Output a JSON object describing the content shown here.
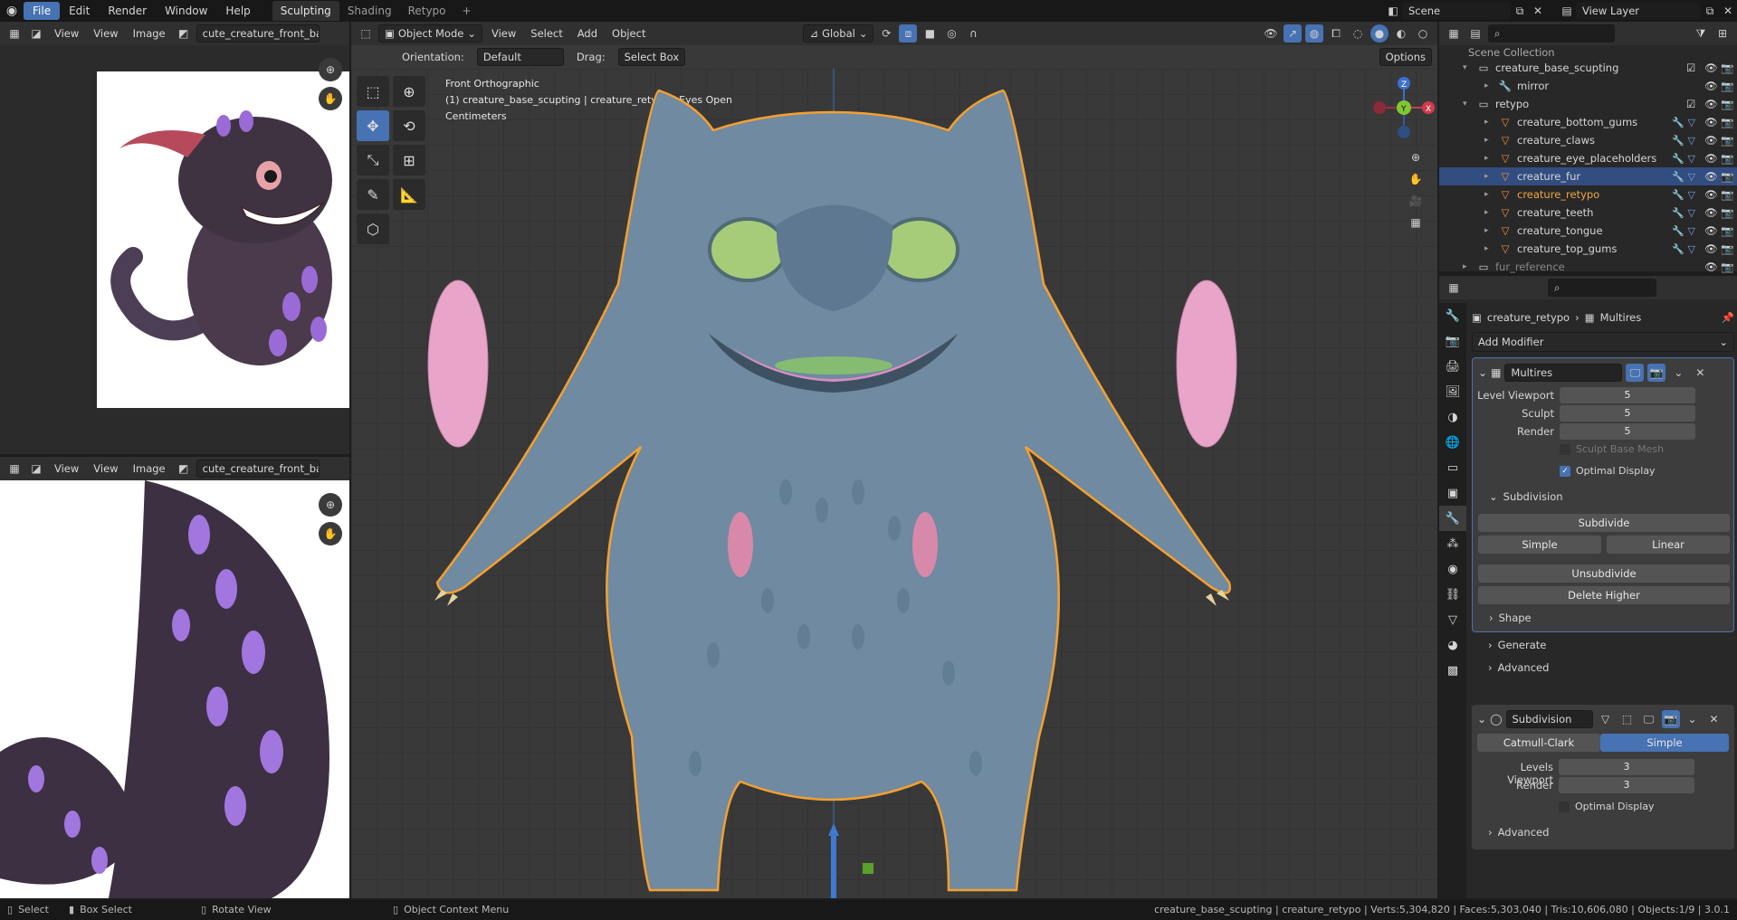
{
  "topbar": {
    "menus": [
      "File",
      "Edit",
      "Render",
      "Window",
      "Help"
    ],
    "workspaces": [
      "Sculpting",
      "Shading",
      "Retypo"
    ],
    "add_tab": "+",
    "scene": "Scene",
    "view_layer": "View Layer"
  },
  "image_editor_top": {
    "view": "View",
    "view2": "View",
    "image": "Image",
    "filename": "cute_creature_front_back."
  },
  "image_editor_bottom": {
    "view": "View",
    "view2": "View",
    "image": "Image",
    "filename": "cute_creature_front_back."
  },
  "viewport": {
    "mode": "Object Mode",
    "menus": [
      "View",
      "Select",
      "Add",
      "Object"
    ],
    "transform": "Global",
    "orientation_label": "Orientation:",
    "orientation_value": "Default",
    "drag_label": "Drag:",
    "drag_value": "Select Box",
    "options": "Options",
    "overlay_line1": "Front Orthographic",
    "overlay_line2": "(1) creature_base_scupting | creature_retypo : Eyes Open",
    "overlay_line3": "Centimeters",
    "gizmo": {
      "z": "Z",
      "y": "Y",
      "x": "X"
    }
  },
  "outliner": {
    "collection_header": "Scene Collection",
    "rows": [
      {
        "name": "creature_base_scupting",
        "level": 1,
        "type": "collection"
      },
      {
        "name": "mirror",
        "level": 2,
        "type": "modifier"
      },
      {
        "name": "retypo",
        "level": 1,
        "type": "collection"
      },
      {
        "name": "creature_bottom_gums",
        "level": 2,
        "type": "mesh"
      },
      {
        "name": "creature_claws",
        "level": 2,
        "type": "mesh"
      },
      {
        "name": "creature_eye_placeholders",
        "level": 2,
        "type": "mesh"
      },
      {
        "name": "creature_fur",
        "level": 2,
        "type": "mesh"
      },
      {
        "name": "creature_retypo",
        "level": 2,
        "type": "mesh"
      },
      {
        "name": "creature_teeth",
        "level": 2,
        "type": "mesh"
      },
      {
        "name": "creature_tongue",
        "level": 2,
        "type": "mesh"
      },
      {
        "name": "creature_top_gums",
        "level": 2,
        "type": "mesh"
      },
      {
        "name": "fur_reference",
        "level": 1,
        "type": "collection"
      }
    ]
  },
  "properties": {
    "breadcrumb_object": "creature_retypo",
    "breadcrumb_modifier": "Multires",
    "add_modifier": "Add Modifier",
    "multires": {
      "name": "Multires",
      "level_viewport_label": "Level Viewport",
      "level_viewport": "5",
      "sculpt_label": "Sculpt",
      "sculpt": "5",
      "render_label": "Render",
      "render": "5",
      "sculpt_base_mesh": "Sculpt Base Mesh",
      "optimal_display": "Optimal Display",
      "subdivision_panel": "Subdivision",
      "subdivide": "Subdivide",
      "simple": "Simple",
      "linear": "Linear",
      "unsubdivide": "Unsubdivide",
      "delete_higher": "Delete Higher",
      "shape": "Shape",
      "generate": "Generate",
      "advanced": "Advanced"
    },
    "subdivision": {
      "name": "Subdivision",
      "catmull": "Catmull-Clark",
      "simple": "Simple",
      "levels_viewport_label": "Levels Viewport",
      "levels_viewport": "3",
      "render_label": "Render",
      "render": "3",
      "optimal_display": "Optimal Display",
      "advanced": "Advanced"
    }
  },
  "status": {
    "select": "Select",
    "box_select": "Box Select",
    "rotate_view": "Rotate View",
    "context_menu": "Object Context Menu",
    "stats": "creature_base_scupting | creature_retypo | Verts:5,304,820 | Faces:5,303,040 | Tris:10,606,080 | Objects:1/9 | 3.0.1"
  },
  "colors": {
    "accent": "#4772b3",
    "selection_outline": "#f5a030",
    "creature": "#6f8aa1",
    "eyes": "#a6cc7a",
    "pink": "#e8a4c9"
  }
}
